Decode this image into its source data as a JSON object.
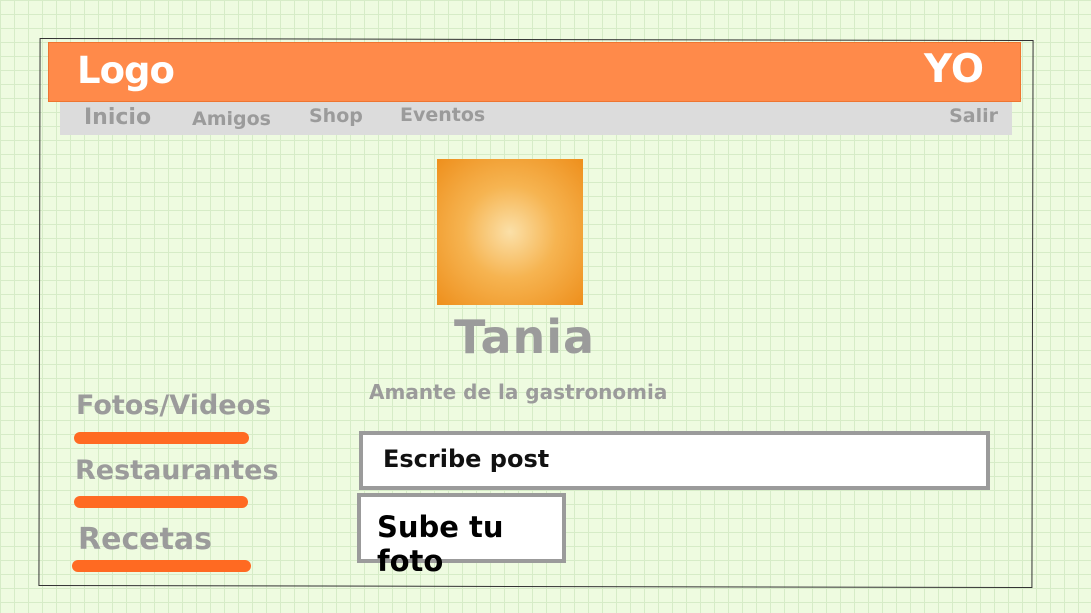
{
  "header": {
    "logo": "Logo",
    "user": "YO"
  },
  "nav": {
    "items": [
      "Inicio",
      "Amigos",
      "Shop",
      "Eventos"
    ],
    "logout": "Salir"
  },
  "profile": {
    "name": "Tania",
    "bio": "Amante de la gastronomia"
  },
  "sidebar": {
    "links": [
      "Fotos/Videos",
      "Restaurantes",
      "Recetas"
    ]
  },
  "composer": {
    "post_placeholder": "Escribe post",
    "upload_label": "Sube tu foto"
  },
  "colors": {
    "header": "#ff8a4a",
    "accent": "#ff6a22",
    "nav_bg": "#dcdcdc",
    "muted_text": "#9b9b9b",
    "background": "#eefbe0"
  }
}
